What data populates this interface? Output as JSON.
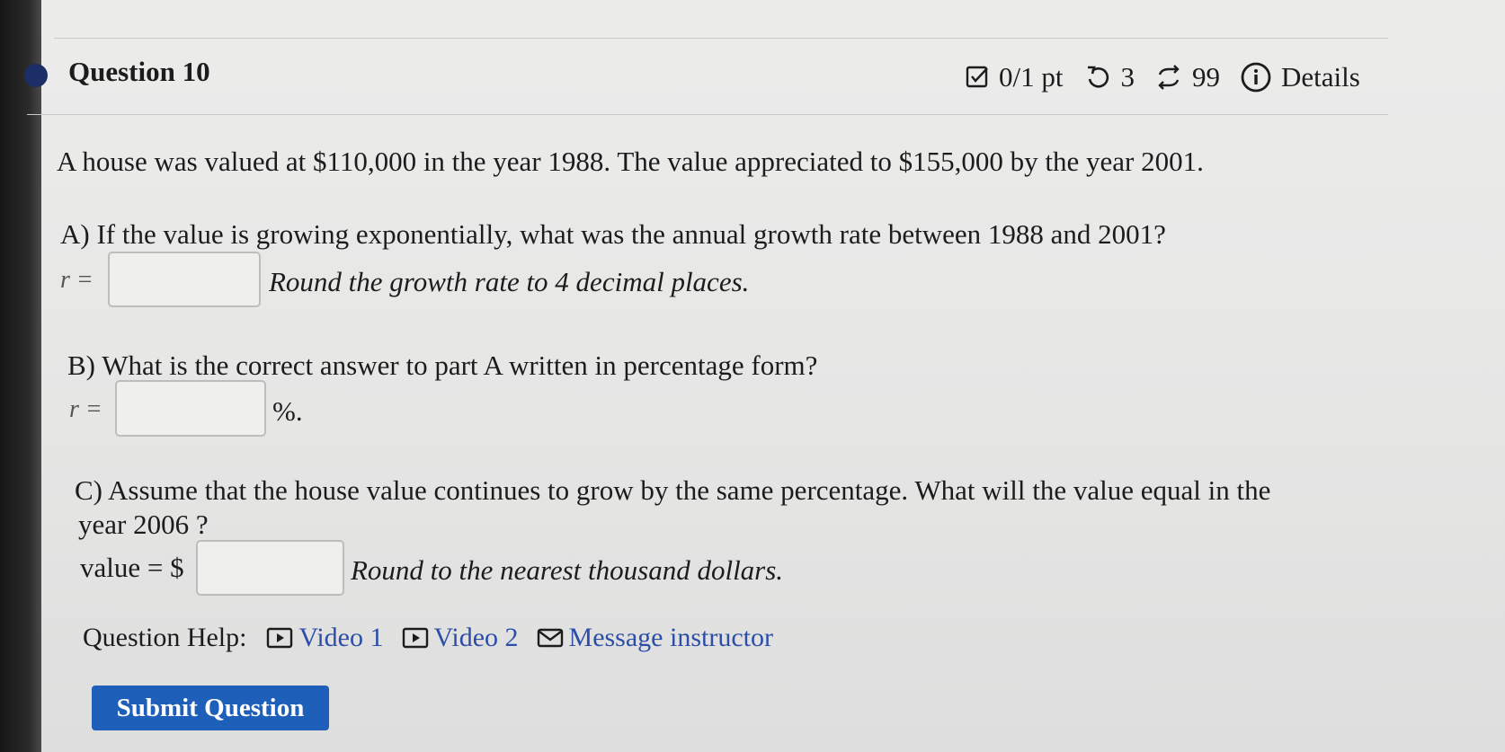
{
  "question": {
    "title": "Question 10",
    "score": "0/1 pt",
    "retries": "3",
    "attempts": "99",
    "details_label": "Details"
  },
  "problem": {
    "intro": "A house was valued at $110,000 in the year 1988. The value appreciated to $155,000 by the year 2001.",
    "part_a": {
      "prompt": "A) If the value is growing exponentially, what was the annual growth rate between 1988 and 2001?",
      "var_label": "r =",
      "value": "",
      "hint": "Round the growth rate to 4 decimal places."
    },
    "part_b": {
      "prompt": "B) What is the correct answer to part A written in percentage form?",
      "var_label": "r =",
      "value": "",
      "suffix": "%."
    },
    "part_c": {
      "prompt_line1": "C) Assume that the house value continues to grow by the same percentage. What will the value equal in the",
      "prompt_line2": "year 2006 ?",
      "var_label": "value = $",
      "value": "",
      "hint": "Round to the nearest thousand dollars."
    }
  },
  "help": {
    "label": "Question Help:",
    "video1": "Video 1",
    "video2": "Video 2",
    "message": "Message instructor"
  },
  "submit_label": "Submit Question",
  "colors": {
    "accent_dot": "#1b2f66",
    "link": "#2c4ea8",
    "submit_bg": "#1e5fb9"
  },
  "icons": [
    "score-check-icon",
    "retry-icon",
    "attempts-icon",
    "info-icon",
    "video-icon",
    "mail-icon"
  ]
}
